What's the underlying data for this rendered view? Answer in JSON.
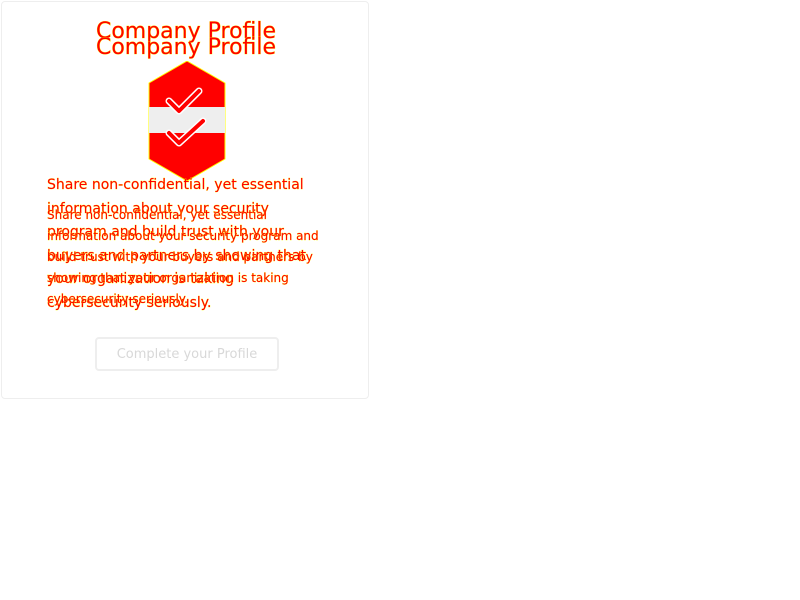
{
  "card": {
    "title": "Company Profile",
    "title_repeat": "Company Profile",
    "badge_icon": "shield-checkmark-icon",
    "description": "Share non-confidential, yet essential information about your security program and build trust with your buyers and partners by showing that your organization is taking cybersecurity seriously.",
    "description_repeat": "Share non-confidential, yet essential information about your security program and build trust with your buyers and partners by showing that your organization is taking cybersecurity seriously.",
    "cta_label": "Complete your Profile"
  },
  "colors": {
    "accent": "#ff0000",
    "outline": "#ffff00",
    "badge_band": "#eeeeee",
    "border": "#eeeeee",
    "button_text": "#d8d8d8"
  }
}
